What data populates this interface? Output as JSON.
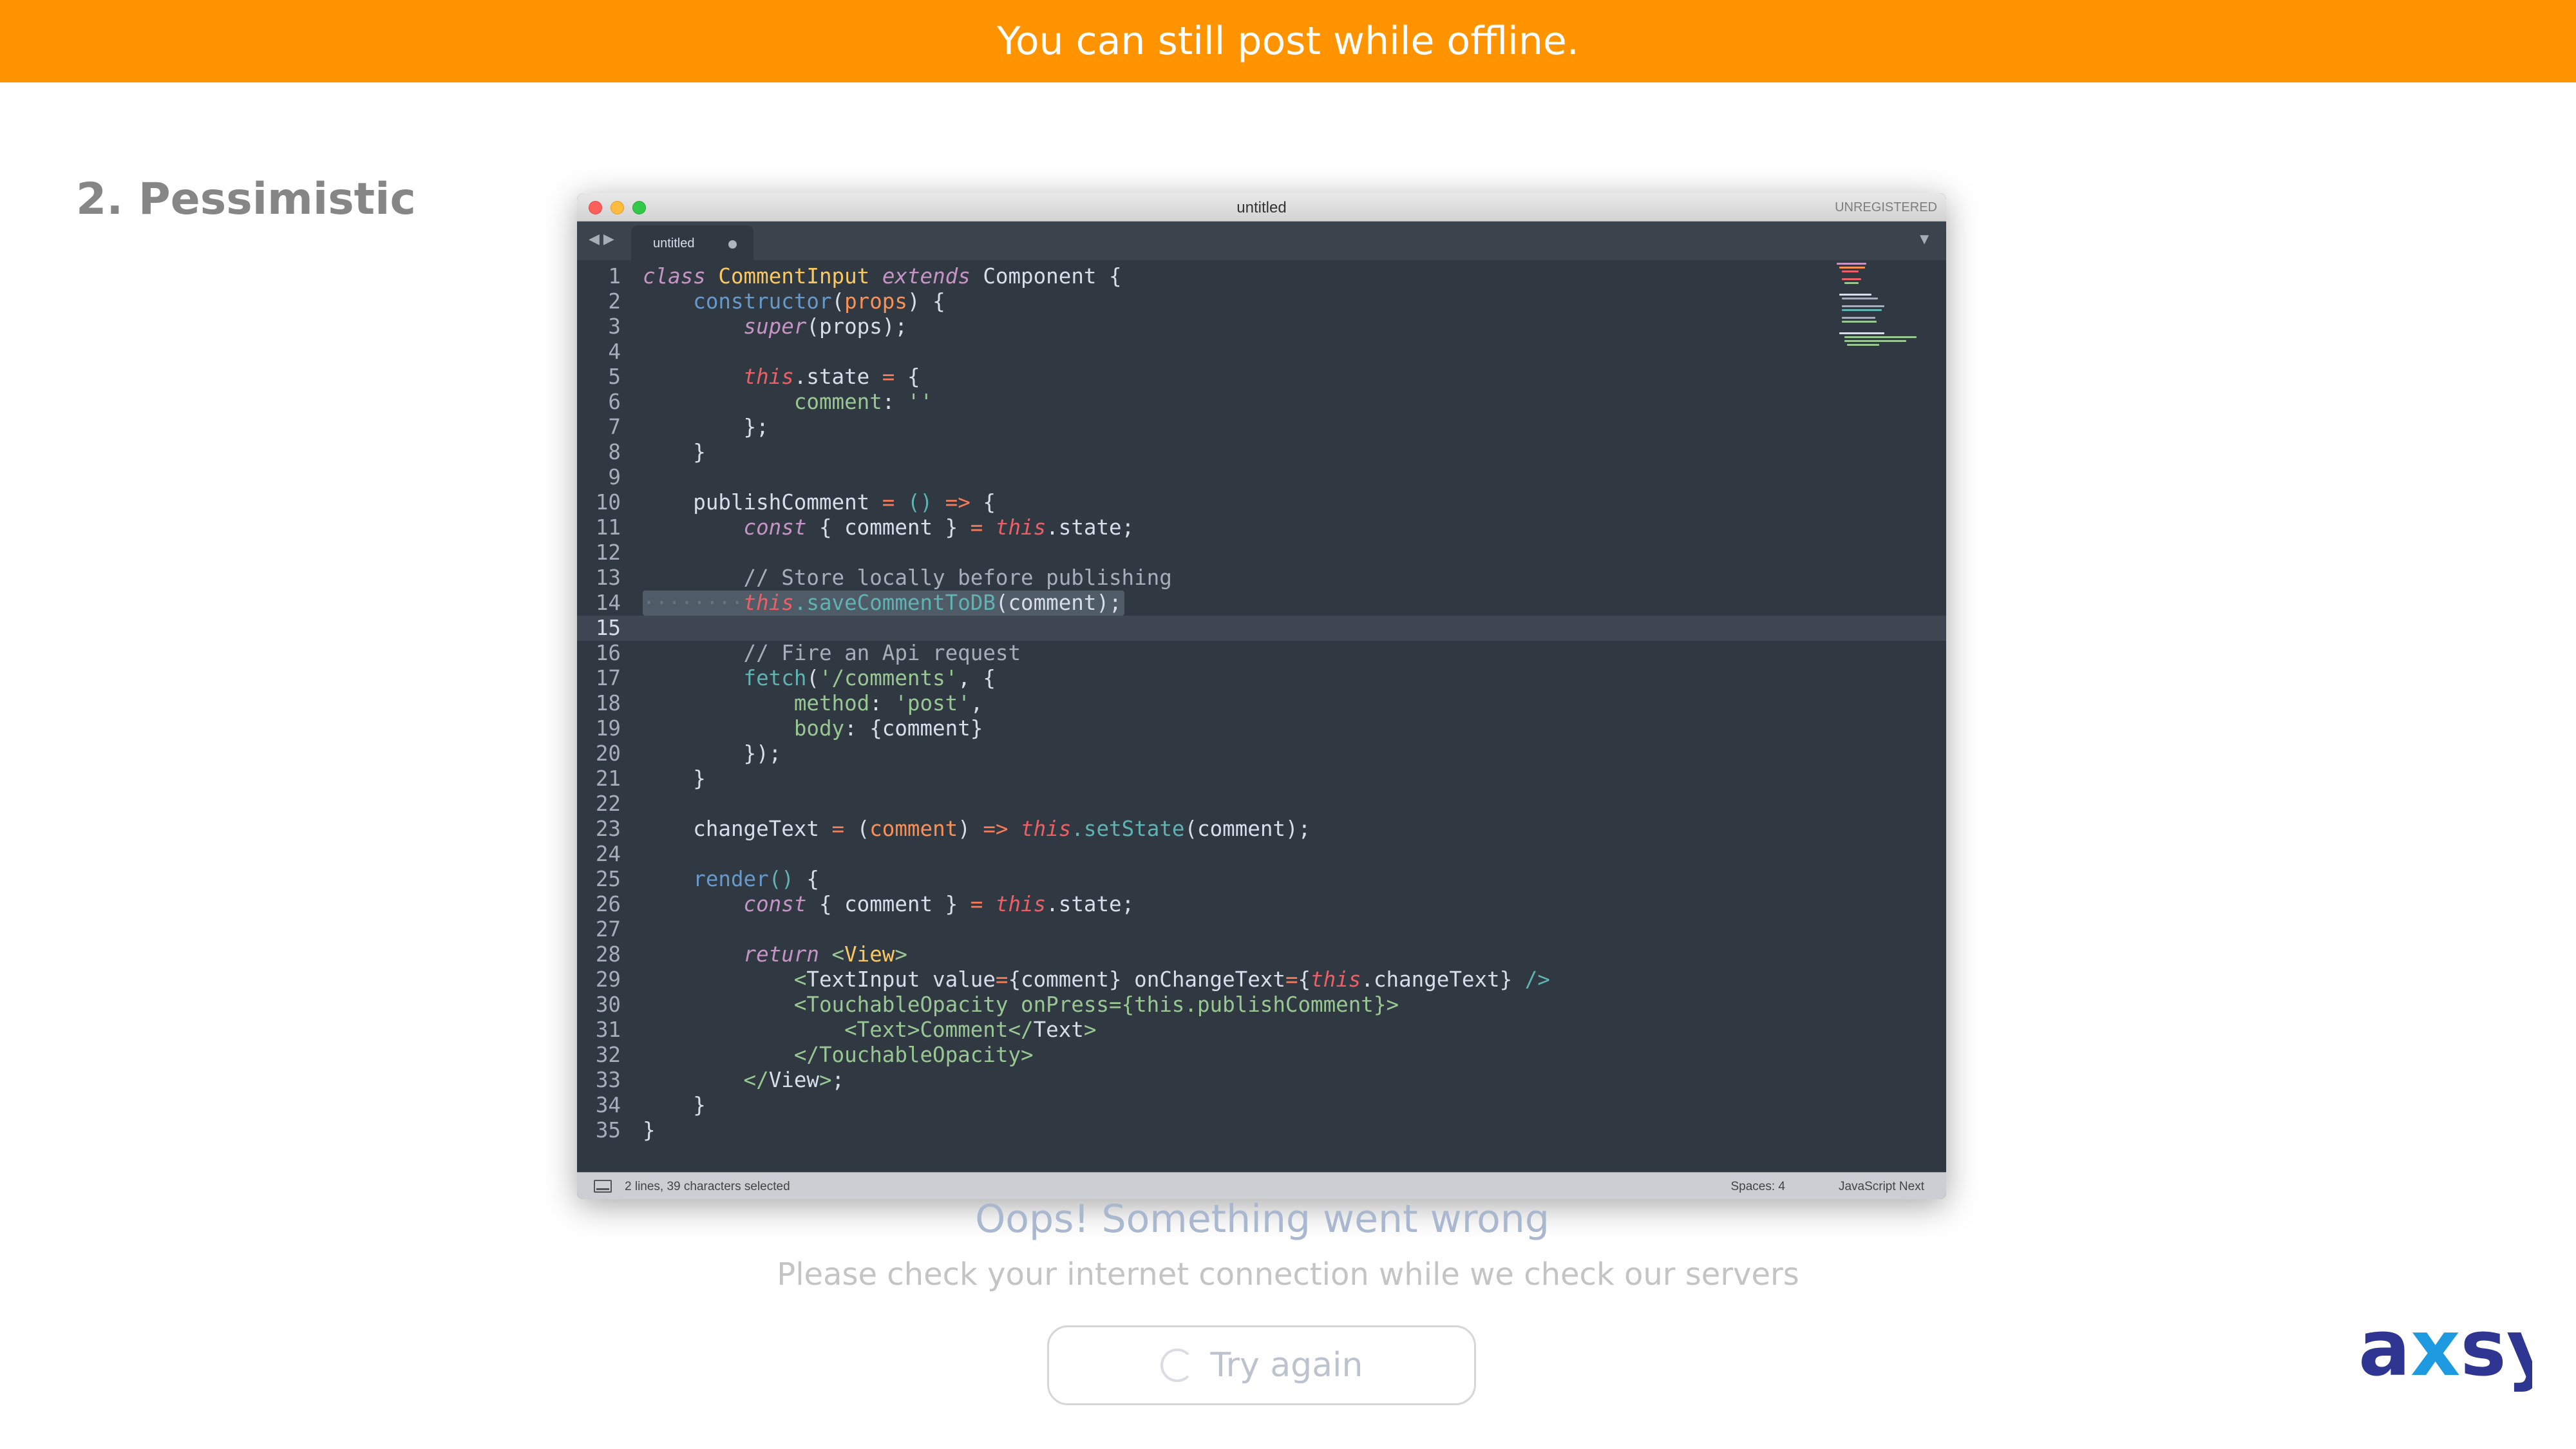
{
  "banner": {
    "message": "You can still post while offline.",
    "background": "#ff9400"
  },
  "slide": {
    "title": "2. Pessimistic"
  },
  "editor": {
    "window_title": "untitled",
    "license_status": "UNREGISTERED",
    "tab_label": "untitled",
    "status_selection": "2 lines, 39 characters selected",
    "status_spaces": "Spaces: 4",
    "status_syntax": "JavaScript Next",
    "current_line": 15,
    "code_lines": [
      [
        [
          "kw",
          "class"
        ],
        [
          "p",
          " "
        ],
        [
          "cls",
          "CommentInput"
        ],
        [
          "p",
          " "
        ],
        [
          "kw",
          "extends"
        ],
        [
          "p",
          " Component {"
        ]
      ],
      [
        [
          "p",
          "    "
        ],
        [
          "fn",
          "constructor"
        ],
        [
          "pun",
          "("
        ],
        [
          "prm",
          "props"
        ],
        [
          "pun",
          ")"
        ],
        [
          "p",
          " {"
        ]
      ],
      [
        [
          "p",
          "        "
        ],
        [
          "kw",
          "super"
        ],
        [
          "p",
          "(props);"
        ]
      ],
      [],
      [
        [
          "p",
          "        "
        ],
        [
          "this",
          "this"
        ],
        [
          "p",
          ".state "
        ],
        [
          "op",
          "="
        ],
        [
          "p",
          " {"
        ]
      ],
      [
        [
          "p",
          "            "
        ],
        [
          "str",
          "comment"
        ],
        [
          "p",
          ": "
        ],
        [
          "str",
          "''"
        ]
      ],
      [
        [
          "p",
          "        };"
        ]
      ],
      [
        [
          "p",
          "    }"
        ]
      ],
      [],
      [
        [
          "p",
          "    publishComment "
        ],
        [
          "op",
          "="
        ],
        [
          "p",
          " "
        ],
        [
          "ttl",
          "()"
        ],
        [
          "p",
          " "
        ],
        [
          "op",
          "=>"
        ],
        [
          "p",
          " {"
        ]
      ],
      [
        [
          "p",
          "        "
        ],
        [
          "kw",
          "const"
        ],
        [
          "p",
          " { comment } "
        ],
        [
          "op",
          "="
        ],
        [
          "p",
          " "
        ],
        [
          "this",
          "this"
        ],
        [
          "p",
          ".state;"
        ]
      ],
      [],
      [
        [
          "p",
          "        "
        ],
        [
          "cmt",
          "// Store locally before publishing"
        ]
      ],
      [
        [
          "wsp",
          "········"
        ],
        [
          "this",
          "this"
        ],
        [
          "ttl",
          ".saveCommentToDB"
        ],
        [
          "p",
          "(comment);"
        ]
      ],
      [],
      [
        [
          "p",
          "        "
        ],
        [
          "cmt",
          "// Fire an Api request"
        ]
      ],
      [
        [
          "p",
          "        "
        ],
        [
          "ttl",
          "fetch"
        ],
        [
          "p",
          "("
        ],
        [
          "str",
          "'/comments'"
        ],
        [
          "p",
          ", {"
        ]
      ],
      [
        [
          "p",
          "            "
        ],
        [
          "str",
          "method"
        ],
        [
          "p",
          ": "
        ],
        [
          "str",
          "'post'"
        ],
        [
          "p",
          ","
        ]
      ],
      [
        [
          "p",
          "            "
        ],
        [
          "str",
          "body"
        ],
        [
          "p",
          ": {comment}"
        ]
      ],
      [
        [
          "p",
          "        });"
        ]
      ],
      [
        [
          "p",
          "    }"
        ]
      ],
      [],
      [
        [
          "p",
          "    changeText "
        ],
        [
          "op",
          "="
        ],
        [
          "p",
          " "
        ],
        [
          "pun",
          "("
        ],
        [
          "prm",
          "comment"
        ],
        [
          "pun",
          ")"
        ],
        [
          "p",
          " "
        ],
        [
          "op",
          "=>"
        ],
        [
          "p",
          " "
        ],
        [
          "this",
          "this"
        ],
        [
          "ttl",
          ".setState"
        ],
        [
          "p",
          "(comment);"
        ]
      ],
      [],
      [
        [
          "p",
          "    "
        ],
        [
          "fn",
          "render"
        ],
        [
          "ttl",
          "()"
        ],
        [
          "p",
          " {"
        ]
      ],
      [
        [
          "p",
          "        "
        ],
        [
          "kw",
          "const"
        ],
        [
          "p",
          " { comment } "
        ],
        [
          "op",
          "="
        ],
        [
          "p",
          " "
        ],
        [
          "this",
          "this"
        ],
        [
          "p",
          ".state;"
        ]
      ],
      [],
      [
        [
          "p",
          "        "
        ],
        [
          "kw",
          "return"
        ],
        [
          "p",
          " "
        ],
        [
          "tag",
          "<"
        ],
        [
          "cls",
          "View"
        ],
        [
          "tag",
          ">"
        ]
      ],
      [
        [
          "p",
          "            "
        ],
        [
          "tag",
          "<"
        ],
        [
          "p",
          "TextInput value"
        ],
        [
          "op",
          "="
        ],
        [
          "p",
          "{comment} onChangeText"
        ],
        [
          "op",
          "="
        ],
        [
          "p",
          "{"
        ],
        [
          "this",
          "this"
        ],
        [
          "p",
          ".changeText} "
        ],
        [
          "ttl",
          "/>"
        ]
      ],
      [
        [
          "p",
          "            "
        ],
        [
          "tag",
          "<TouchableOpacity onPress={this.publishComment}>"
        ]
      ],
      [
        [
          "p",
          "                "
        ],
        [
          "tag",
          "<Text>Comment</"
        ],
        [
          "p",
          "Text"
        ],
        [
          "tag",
          ">"
        ]
      ],
      [
        [
          "p",
          "            "
        ],
        [
          "tag",
          "</TouchableOpacity>"
        ]
      ],
      [
        [
          "p",
          "        "
        ],
        [
          "tag",
          "</"
        ],
        [
          "p",
          "View"
        ],
        [
          "tag",
          ">"
        ],
        [
          "p",
          ";"
        ]
      ],
      [
        [
          "p",
          "    }"
        ]
      ],
      [
        [
          "p",
          "}"
        ]
      ]
    ]
  },
  "error": {
    "title": "Oops! Something went wrong",
    "subtitle": "Please check your internet connection while we check our servers",
    "retry_label": "Try again",
    "retry_icon": "refresh-icon"
  },
  "logo": {
    "text": "axsy",
    "color_primary": "#2f3691",
    "color_accent": "#1e9be0"
  }
}
